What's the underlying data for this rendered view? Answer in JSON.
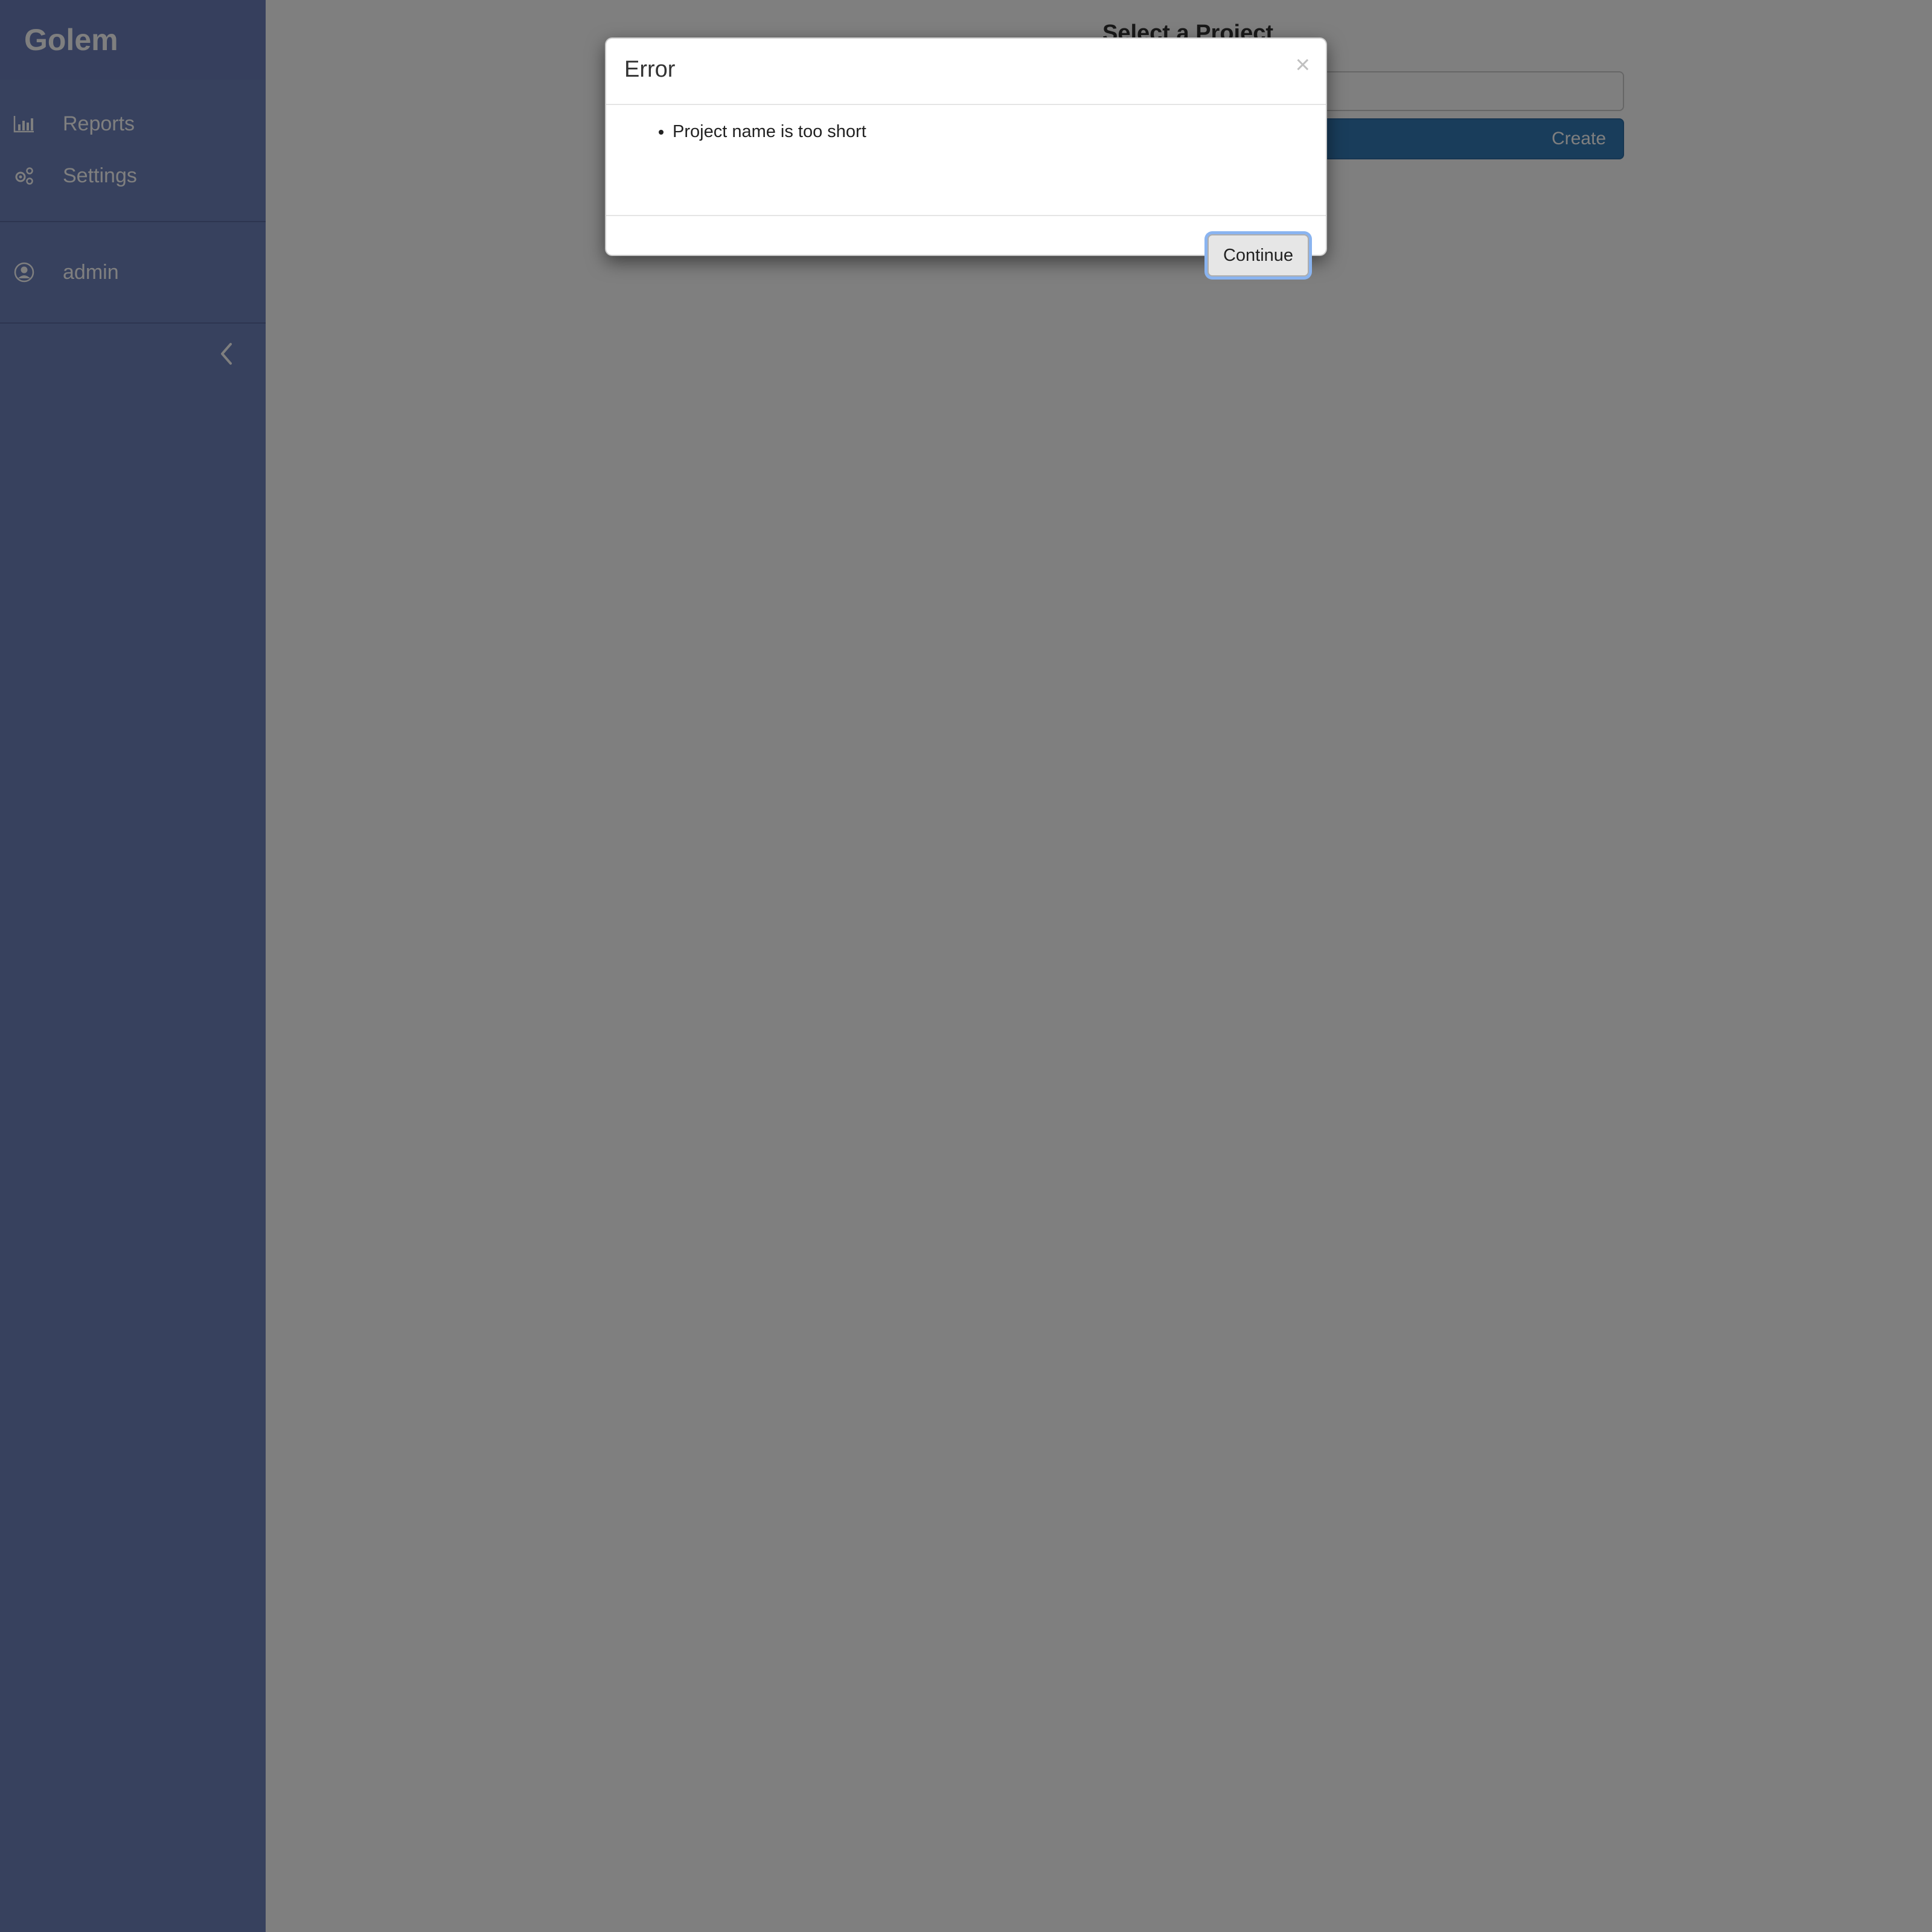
{
  "sidebar": {
    "brand": "Golem",
    "items": [
      {
        "label": "Reports",
        "icon": "bar-chart-icon"
      },
      {
        "label": "Settings",
        "icon": "gears-icon"
      }
    ],
    "user": {
      "label": "admin",
      "icon": "user-circle-icon"
    },
    "collapse_icon": "chevron-left-icon"
  },
  "main": {
    "title": "Select a Project",
    "create_label": "Create"
  },
  "modal": {
    "title": "Error",
    "close_glyph": "×",
    "errors": [
      "Project name is too short"
    ],
    "continue_label": "Continue"
  },
  "colors": {
    "sidebar_bg": "#6f82bd",
    "overlay": "rgba(0,0,0,0.5)",
    "primary": "#337ab7",
    "focus_ring": "#8ab4f0"
  }
}
